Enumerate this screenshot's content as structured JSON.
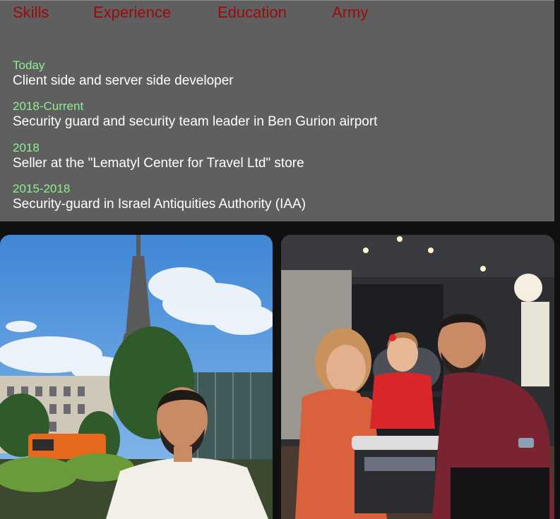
{
  "nav": {
    "tabs": [
      "Skills",
      "Experience",
      "Education",
      "Army"
    ]
  },
  "experience": [
    {
      "date": "Today",
      "description": "Client side and server side developer"
    },
    {
      "date": "2018-Current",
      "description": "Security guard and security team leader in Ben Gurion airport"
    },
    {
      "date": "2018",
      "description": "Seller at the \"Lematyl Center for Travel Ltd\" store"
    },
    {
      "date": "2015-2018",
      "description": "Security-guard in Israel Antiquities Authority (IAA)"
    }
  ],
  "colors": {
    "panel_bg": "#5f5f5f",
    "page_bg": "#101010",
    "tab_text": "#9b0b0b",
    "date_text": "#90ee90",
    "description_text": "#ffffff"
  },
  "photos": [
    {
      "subject": "man-at-eiffel-tower-photo"
    },
    {
      "subject": "family-with-stroller-photo"
    }
  ]
}
